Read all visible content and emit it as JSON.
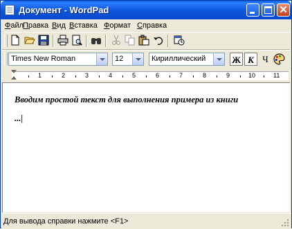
{
  "window": {
    "title": "Документ - WordPad",
    "icon": "wordpad-document-icon",
    "controls": [
      "minimize-icon",
      "maximize-icon",
      "close-icon"
    ],
    "titlebar_color": "#0a5eea",
    "close_color": "#c9411a"
  },
  "menu": {
    "items": [
      {
        "label": "Файл"
      },
      {
        "label": "Правка"
      },
      {
        "label": "Вид"
      },
      {
        "label": "Вставка"
      },
      {
        "label": "Формат"
      },
      {
        "label": "Справка"
      }
    ]
  },
  "toolbar": {
    "buttons": [
      "new-icon",
      "open-icon",
      "save-icon",
      "print-icon",
      "print-preview-icon",
      "find-icon",
      "cut-icon",
      "copy-icon",
      "paste-icon",
      "undo-icon",
      "date-time-icon"
    ]
  },
  "format_bar": {
    "font": "Times New Roman",
    "size": "12",
    "script": "Кириллический",
    "bold": "Ж",
    "italic": "К",
    "underline": "Ч",
    "color_icon": "color-palette-icon"
  },
  "ruler": {
    "numbers": [
      "1",
      "2",
      "3",
      "4",
      "5",
      "6",
      "7",
      "8",
      "9",
      "10",
      "11"
    ]
  },
  "document": {
    "line1": "Вводим простой текст для выполнения примера из книги",
    "line2": "...|"
  },
  "status": {
    "text": "Для вывода справки нажмите <F1>"
  }
}
